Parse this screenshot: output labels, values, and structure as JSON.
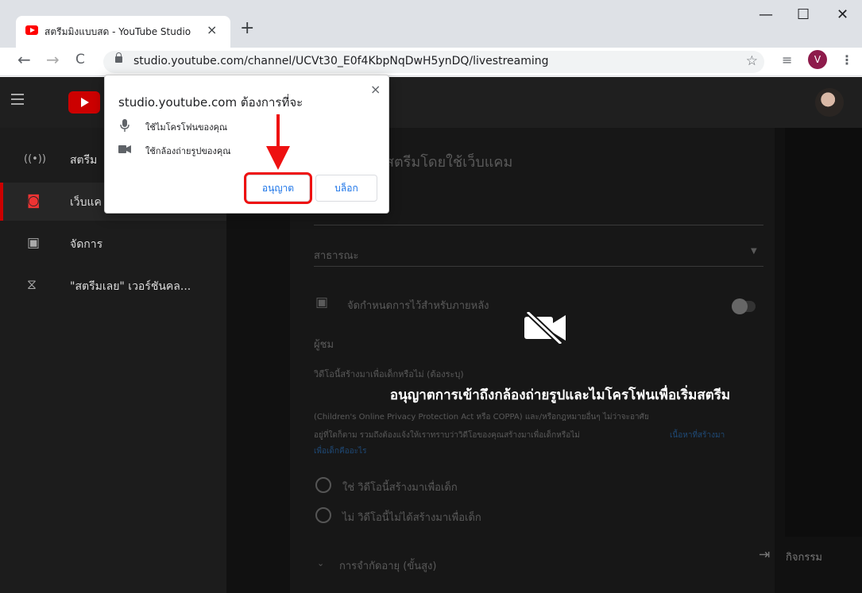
{
  "browser": {
    "tab_title": "สตรีมมิงแบบสด - YouTube Studio",
    "tab_close": "×",
    "new_tab": "+",
    "window_controls": {
      "minimize": "—",
      "maximize": "☐",
      "close": "✕"
    },
    "nav": {
      "back": "←",
      "forward": "→",
      "reload": "C"
    },
    "url": "studio.youtube.com/channel/UCVt30_E0f4KbpNqDwH5ynDQ/livestreaming",
    "bookmark_star": "☆",
    "reading_list": "≡",
    "profile_initial": "V",
    "menu": "⋮"
  },
  "sidebar": {
    "items": [
      {
        "icon": "live-icon",
        "glyph": "((•))",
        "label": "สตรีม"
      },
      {
        "icon": "camera-icon",
        "glyph": "◙",
        "label": "เว็บแค"
      },
      {
        "icon": "calendar-icon",
        "glyph": "▣",
        "label": "จัดการ"
      },
      {
        "icon": "classic-icon",
        "glyph": "⧖",
        "label": "\"สตรีมเลย\" เวอร์ชันคล..."
      }
    ]
  },
  "form": {
    "heading": "สตรีมโดยใช้เว็บแคม",
    "visibility": "สาธารณะ",
    "schedule_label": "จัดกำหนดการไว้สำหรับภายหลัง",
    "audience_heading": "ผู้ชม",
    "kids_question": "วิดีโอนี้สร้างมาเพื่อเด็กหรือไม่ (ต้องระบุ)",
    "coppa_line": "(Children's Online Privacy Protection Act หรือ COPPA) และ/หรือกฎหมายอื่นๆ ไม่ว่าจะอาศัย",
    "notify_line": "อยู่ที่ใดก็ตาม รวมถึงต้องแจ้งให้เราทราบว่าวิดีโอของคุณสร้างมาเพื่อเด็กหรือไม่",
    "link_text": "เนื้อหาที่สร้างมา",
    "link_text_2": "เพื่อเด็กคืออะไร",
    "option_yes": "ใช่ วิดีโอนี้สร้างมาเพื่อเด็ก",
    "option_no": "ไม่ วิดีโอนี้ไม่ได้สร้างมาเพื่อเด็ก",
    "age_restriction": "การจำกัดอายุ (ขั้นสูง)"
  },
  "overlay_message": "อนุญาตการเข้าถึงกล้องถ่ายรูปและไมโครโฟนเพื่อเริ่มสตรีม",
  "activity_label": "กิจกรรม",
  "popup": {
    "title": "studio.youtube.com ต้องการที่จะ",
    "close": "×",
    "permissions": [
      {
        "icon": "microphone-icon",
        "glyph": "🎙",
        "label": "ใช้ไมโครโฟนของคุณ"
      },
      {
        "icon": "video-camera-icon",
        "glyph": "■",
        "label": "ใช้กล้องถ่ายรูปของคุณ"
      }
    ],
    "allow_label": "อนุญาต",
    "block_label": "บล็อก"
  },
  "colors": {
    "highlight": "#e11111",
    "accent": "#1a73e8",
    "brand": "#ff0000"
  }
}
